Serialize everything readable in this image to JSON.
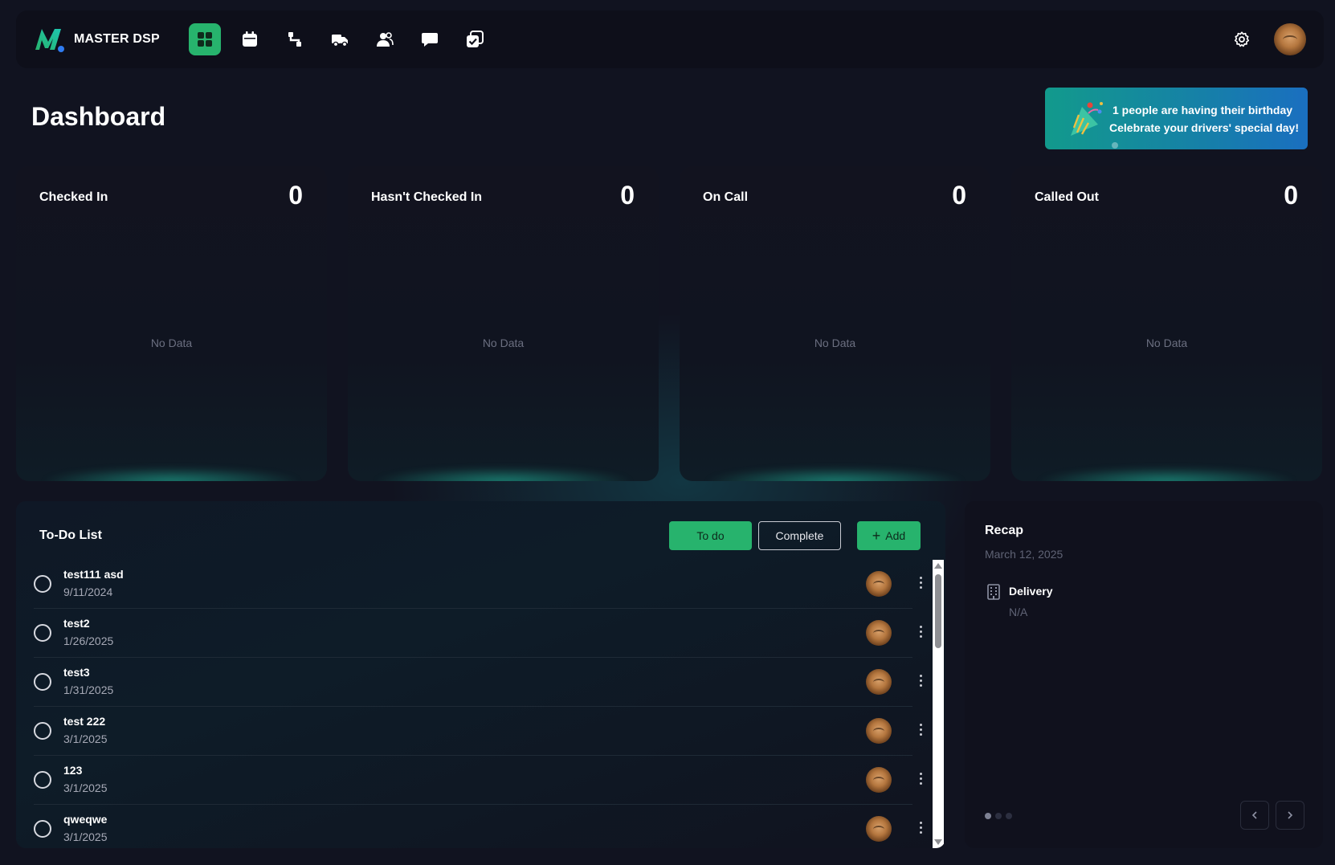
{
  "app": {
    "brand": "MASTER DSP",
    "accent": "#27b36d"
  },
  "nav": {
    "items": [
      {
        "icon": "dashboard-grid-icon",
        "active": true
      },
      {
        "icon": "calendar-icon",
        "active": false
      },
      {
        "icon": "route-icon",
        "active": false
      },
      {
        "icon": "truck-icon",
        "active": false
      },
      {
        "icon": "people-icon",
        "active": false
      },
      {
        "icon": "chat-icon",
        "active": false
      },
      {
        "icon": "tasks-icon",
        "active": false
      }
    ]
  },
  "page": {
    "title": "Dashboard"
  },
  "birthday": {
    "line1": "1 people are having their birthday",
    "line2": "Celebrate your drivers' special day!"
  },
  "stats": [
    {
      "label": "Checked In",
      "count": "0",
      "empty": "No Data"
    },
    {
      "label": "Hasn't Checked In",
      "count": "0",
      "empty": "No Data"
    },
    {
      "label": "On Call",
      "count": "0",
      "empty": "No Data"
    },
    {
      "label": "Called Out",
      "count": "0",
      "empty": "No Data"
    }
  ],
  "todo": {
    "title": "To-Do List",
    "todo_label": "To do",
    "complete_label": "Complete",
    "add_label": "Add",
    "items": [
      {
        "name": "test111 asd",
        "date": "9/11/2024"
      },
      {
        "name": "test2",
        "date": "1/26/2025"
      },
      {
        "name": "test3",
        "date": "1/31/2025"
      },
      {
        "name": "test 222",
        "date": "3/1/2025"
      },
      {
        "name": "123",
        "date": "3/1/2025"
      },
      {
        "name": "qweqwe",
        "date": "3/1/2025"
      }
    ]
  },
  "recap": {
    "title": "Recap",
    "date": "March 12, 2025",
    "item_label": "Delivery",
    "item_value": "N/A",
    "prev_icon": "chevron-left-icon",
    "next_icon": "chevron-right-icon"
  }
}
